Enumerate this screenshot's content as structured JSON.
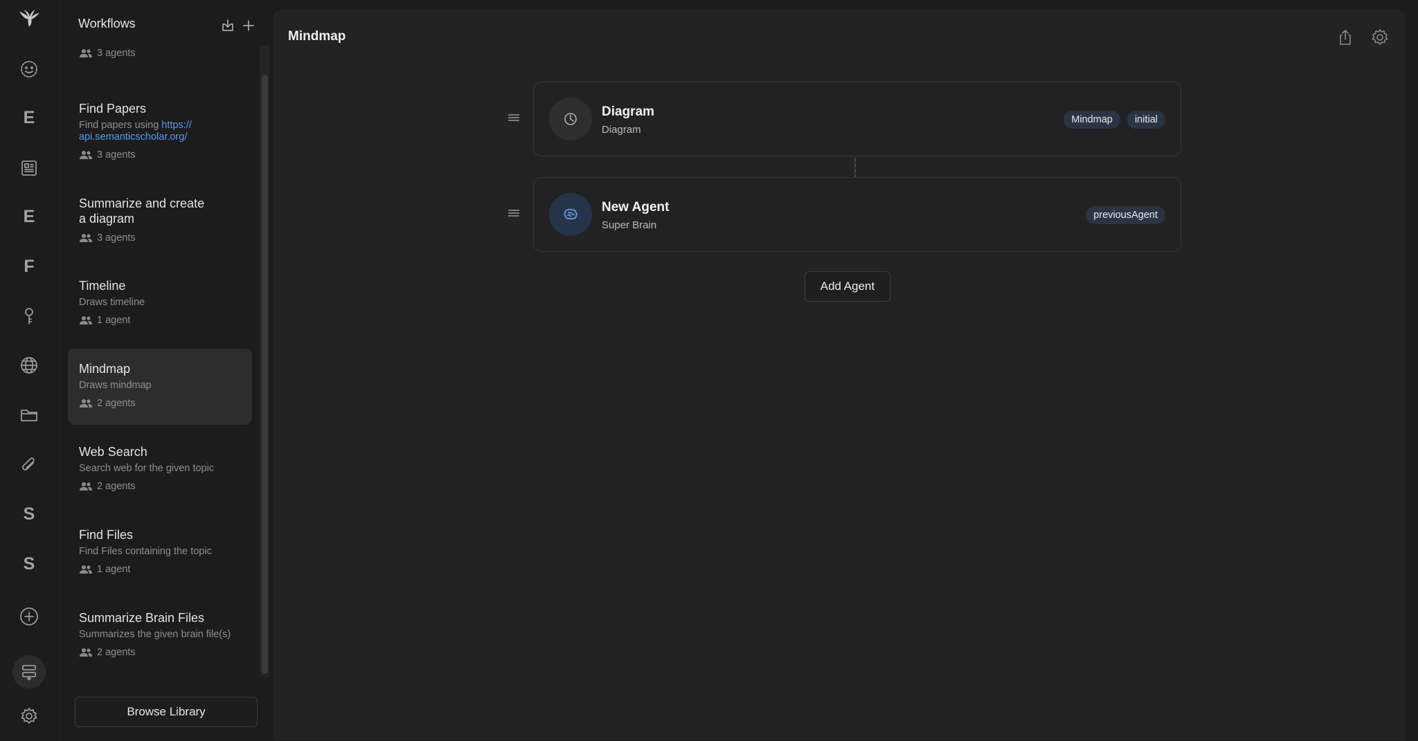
{
  "sidebar": {
    "title": "Workflows",
    "browse_label": "Browse Library",
    "workflows": [
      {
        "name": "",
        "desc": "",
        "agents": "3 agents"
      },
      {
        "name": "Find Papers",
        "desc_prefix": "Find papers using ",
        "desc_link": "https://\napi.semanticscholar.org/",
        "agents": "3 agents"
      },
      {
        "name": "Summarize and create\na diagram",
        "desc": "",
        "agents": "3 agents"
      },
      {
        "name": "Timeline",
        "desc": "Draws timeline",
        "agents": "1 agent"
      },
      {
        "name": "Mindmap",
        "desc": "Draws mindmap",
        "agents": "2 agents"
      },
      {
        "name": "Web Search",
        "desc": "Search web for the given topic",
        "agents": "2 agents"
      },
      {
        "name": "Find Files",
        "desc": "Find Files containing the topic",
        "agents": "1 agent"
      },
      {
        "name": "Summarize Brain Files",
        "desc": "Summarizes the given brain file(s)",
        "agents": "2 agents"
      }
    ]
  },
  "rail": {
    "letters": [
      "E",
      "E",
      "F",
      "S",
      "S"
    ]
  },
  "main": {
    "title": "Mindmap",
    "cards": [
      {
        "name": "Diagram",
        "sub": "Diagram",
        "tags": [
          "Mindmap",
          "initial"
        ]
      },
      {
        "name": "New Agent",
        "sub": "Super Brain",
        "tags": [
          "previousAgent"
        ]
      }
    ],
    "add_agent_label": "Add Agent"
  },
  "colors": {
    "accent_link": "#4f9cf5",
    "tag_bg": "#2b3443"
  }
}
